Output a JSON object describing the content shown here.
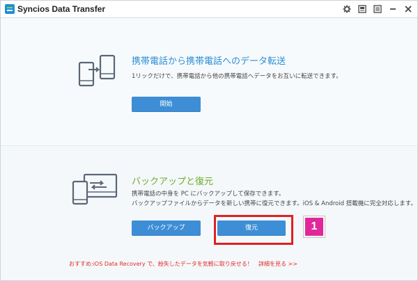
{
  "window": {
    "title": "Syncios Data Transfer",
    "controls": [
      "gear-icon",
      "skin-icon",
      "menu-icon",
      "minimize-icon",
      "close-icon"
    ]
  },
  "transfer": {
    "title": "携帯電話から携帯電話へのデータ転送",
    "description": "1リックだけで、携帯電話から他の携帯電話へデータをお互いに転送できます。",
    "start_button": "開始",
    "icon": "phone-to-phone-icon"
  },
  "backup": {
    "title": "バックアップと復元",
    "description_line1": "携帯電話の中身を PC にバックアップして保存できます。",
    "description_line2": "バックアップファイルからデータを新しい携帯に復元できます。iOS & Android 搭載機に完全対応します。",
    "backup_button": "バックアップ",
    "restore_button": "復元",
    "icon": "phone-to-pc-icon"
  },
  "annotation": {
    "step_number": "1",
    "highlight_color": "#e02020",
    "badge_color": "#e0289a"
  },
  "footer": {
    "promo": "おすすめ:iOS Data Recovery で、紛失したデータを気軽に取り戻せる！",
    "more_link": "詳細を見る >>"
  },
  "colors": {
    "accent_blue": "#3d8ed6",
    "title_blue": "#2a8fd6",
    "title_green": "#6aaa2c",
    "promo_red": "#e02b2b"
  }
}
